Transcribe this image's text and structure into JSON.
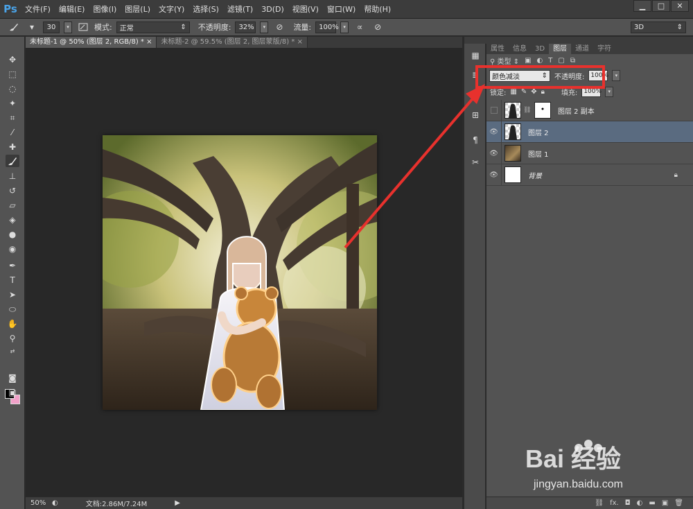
{
  "app": {
    "logo": "Ps"
  },
  "menu": [
    "文件(F)",
    "编辑(E)",
    "图像(I)",
    "图层(L)",
    "文字(Y)",
    "选择(S)",
    "滤镜(T)",
    "3D(D)",
    "视图(V)",
    "窗口(W)",
    "帮助(H)"
  ],
  "window_buttons": {
    "minimize": "▁",
    "maximize": "□",
    "close": "✕"
  },
  "options": {
    "brush_size": "30",
    "mode_label": "模式:",
    "mode_value": "正常",
    "opacity_label": "不透明度:",
    "opacity_value": "32%",
    "flow_label": "流量:",
    "flow_value": "100%",
    "workspace": "3D"
  },
  "tabs": [
    {
      "label": "未标题-1 @ 50% (图层 2, RGB/8) *",
      "active": true
    },
    {
      "label": "未标题-2 @ 59.5% (图层 2, 图层蒙版/8) *",
      "active": false
    }
  ],
  "status": {
    "zoom": "50%",
    "doc": "文档:2.86M/7.24M"
  },
  "panel": {
    "tabs": [
      "属性",
      "信息",
      "3D",
      "图层",
      "通道",
      "字符"
    ],
    "active_tab": "图层",
    "filter_kind": "类型",
    "blend_mode": "颜色减淡",
    "opacity_label": "不透明度:",
    "opacity_value": "100%",
    "lock_label": "锁定:",
    "fill_label": "填充:",
    "fill_value": "100%",
    "layers": [
      {
        "name": "图层 2 副本",
        "visible": false,
        "selected": false,
        "kind": "masked"
      },
      {
        "name": "图层 2",
        "visible": true,
        "selected": true,
        "kind": "transparent"
      },
      {
        "name": "图层 1",
        "visible": true,
        "selected": false,
        "kind": "photo"
      },
      {
        "name": "背景",
        "visible": true,
        "selected": false,
        "kind": "background",
        "locked": true
      }
    ],
    "bottom_icons": [
      "link-icon",
      "fx-icon",
      "mask-icon",
      "adjustment-icon",
      "folder-icon",
      "new-layer-icon",
      "trash-icon"
    ],
    "fx_label": "fx."
  },
  "watermark": {
    "text": "Bai 经验",
    "url": "jingyan.baidu.com"
  },
  "colors": {
    "accent": "#e8312d",
    "selected_layer": "#5a6b80",
    "ps_blue": "#4aa3e8"
  }
}
